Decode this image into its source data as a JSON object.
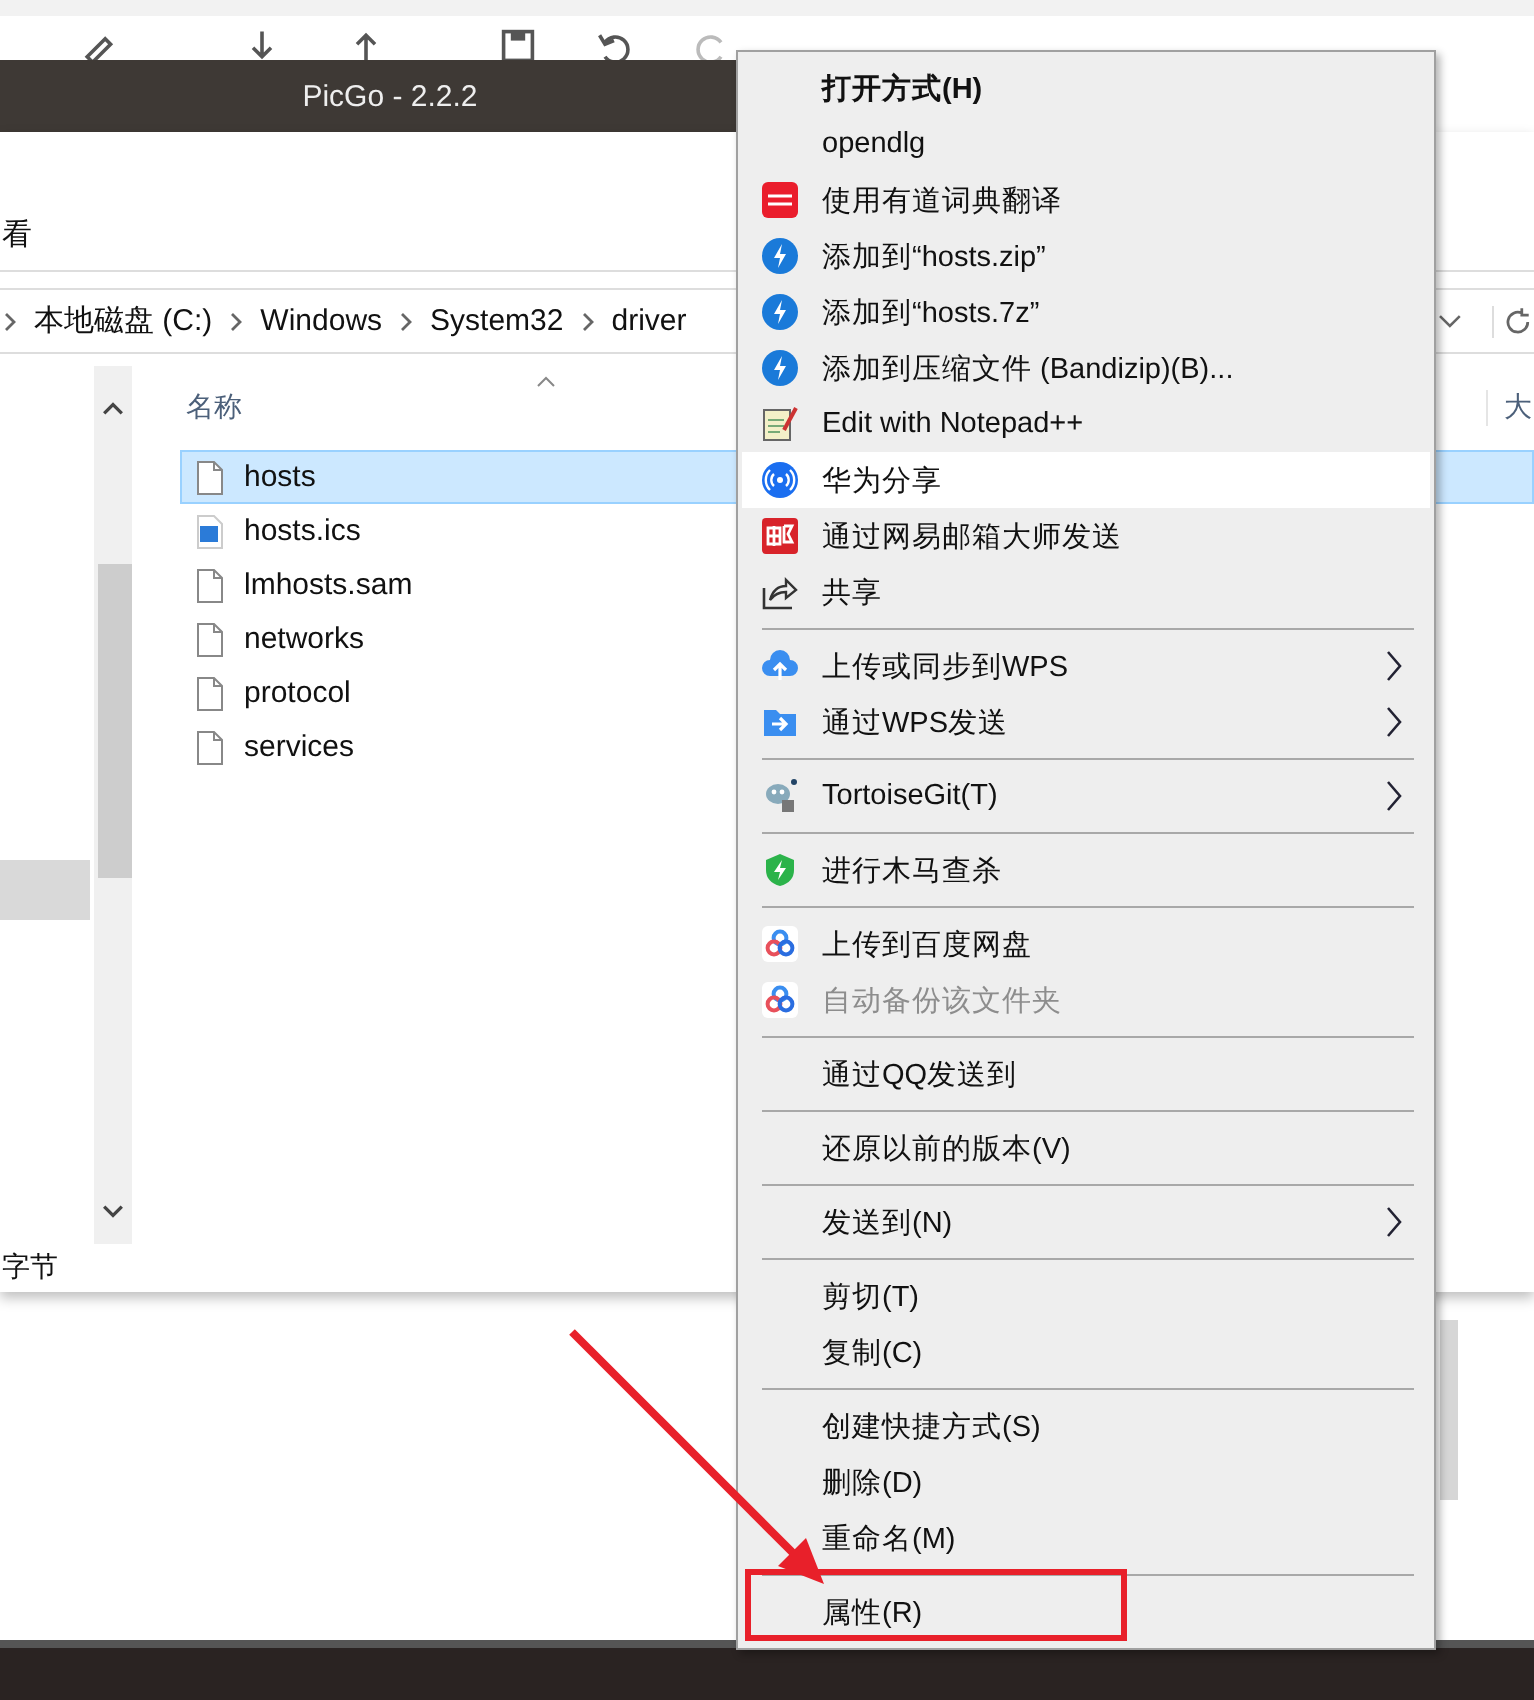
{
  "app_window": {
    "title": "PicGo - 2.2.2"
  },
  "explorer": {
    "ribbon_tab": "看",
    "breadcrumbs": [
      "本地磁盘 (C:)",
      "Windows",
      "System32",
      "driver"
    ],
    "columns": [
      "名称",
      "大"
    ],
    "files": [
      {
        "name": "hosts",
        "kind": "file",
        "selected": true
      },
      {
        "name": "hosts.ics",
        "kind": "calendar",
        "selected": false
      },
      {
        "name": "lmhosts.sam",
        "kind": "file",
        "selected": false
      },
      {
        "name": "networks",
        "kind": "file",
        "selected": false
      },
      {
        "name": "protocol",
        "kind": "file",
        "selected": false
      },
      {
        "name": "services",
        "kind": "file",
        "selected": false
      }
    ],
    "status": "字节"
  },
  "context_menu": {
    "groups": [
      {
        "items": [
          {
            "label": "打开方式(H)",
            "default": true,
            "selected": false,
            "disabled": false,
            "submenu": false
          },
          {
            "label": "opendlg",
            "default": false,
            "selected": false,
            "disabled": false,
            "submenu": false
          },
          {
            "label": "使用有道词典翻译",
            "default": false,
            "selected": false,
            "disabled": false,
            "submenu": false
          },
          {
            "label": "添加到“hosts.zip”",
            "default": false,
            "selected": false,
            "disabled": false,
            "submenu": false
          },
          {
            "label": "添加到“hosts.7z”",
            "default": false,
            "selected": false,
            "disabled": false,
            "submenu": false
          },
          {
            "label": "添加到压缩文件 (Bandizip)(B)...",
            "default": false,
            "selected": false,
            "disabled": false,
            "submenu": false
          },
          {
            "label": "Edit with Notepad++",
            "default": false,
            "selected": false,
            "disabled": false,
            "submenu": false
          },
          {
            "label": "华为分享",
            "default": false,
            "selected": true,
            "disabled": false,
            "submenu": false
          },
          {
            "label": "通过网易邮箱大师发送",
            "default": false,
            "selected": false,
            "disabled": false,
            "submenu": false
          },
          {
            "label": "共享",
            "default": false,
            "selected": false,
            "disabled": false,
            "submenu": false
          }
        ]
      },
      {
        "items": [
          {
            "label": "上传或同步到WPS",
            "default": false,
            "selected": false,
            "disabled": false,
            "submenu": true
          },
          {
            "label": "通过WPS发送",
            "default": false,
            "selected": false,
            "disabled": false,
            "submenu": true
          }
        ]
      },
      {
        "items": [
          {
            "label": "TortoiseGit(T)",
            "default": false,
            "selected": false,
            "disabled": false,
            "submenu": true
          }
        ]
      },
      {
        "items": [
          {
            "label": "进行木马查杀",
            "default": false,
            "selected": false,
            "disabled": false,
            "submenu": false
          }
        ]
      },
      {
        "items": [
          {
            "label": "上传到百度网盘",
            "default": false,
            "selected": false,
            "disabled": false,
            "submenu": false
          },
          {
            "label": "自动备份该文件夹",
            "default": false,
            "selected": false,
            "disabled": true,
            "submenu": false
          }
        ]
      },
      {
        "items": [
          {
            "label": "通过QQ发送到",
            "default": false,
            "selected": false,
            "disabled": false,
            "submenu": false
          }
        ]
      },
      {
        "items": [
          {
            "label": "还原以前的版本(V)",
            "default": false,
            "selected": false,
            "disabled": false,
            "submenu": false
          }
        ]
      },
      {
        "items": [
          {
            "label": "发送到(N)",
            "default": false,
            "selected": false,
            "disabled": false,
            "submenu": true
          }
        ]
      },
      {
        "items": [
          {
            "label": "剪切(T)",
            "default": false,
            "selected": false,
            "disabled": false,
            "submenu": false
          },
          {
            "label": "复制(C)",
            "default": false,
            "selected": false,
            "disabled": false,
            "submenu": false
          }
        ]
      },
      {
        "items": [
          {
            "label": "创建快捷方式(S)",
            "default": false,
            "selected": false,
            "disabled": false,
            "submenu": false
          },
          {
            "label": "删除(D)",
            "default": false,
            "selected": false,
            "disabled": false,
            "submenu": false
          },
          {
            "label": "重命名(M)",
            "default": false,
            "selected": false,
            "disabled": false,
            "submenu": false
          }
        ]
      },
      {
        "items": [
          {
            "label": "属性(R)",
            "default": false,
            "selected": false,
            "disabled": false,
            "submenu": false
          }
        ]
      }
    ]
  }
}
